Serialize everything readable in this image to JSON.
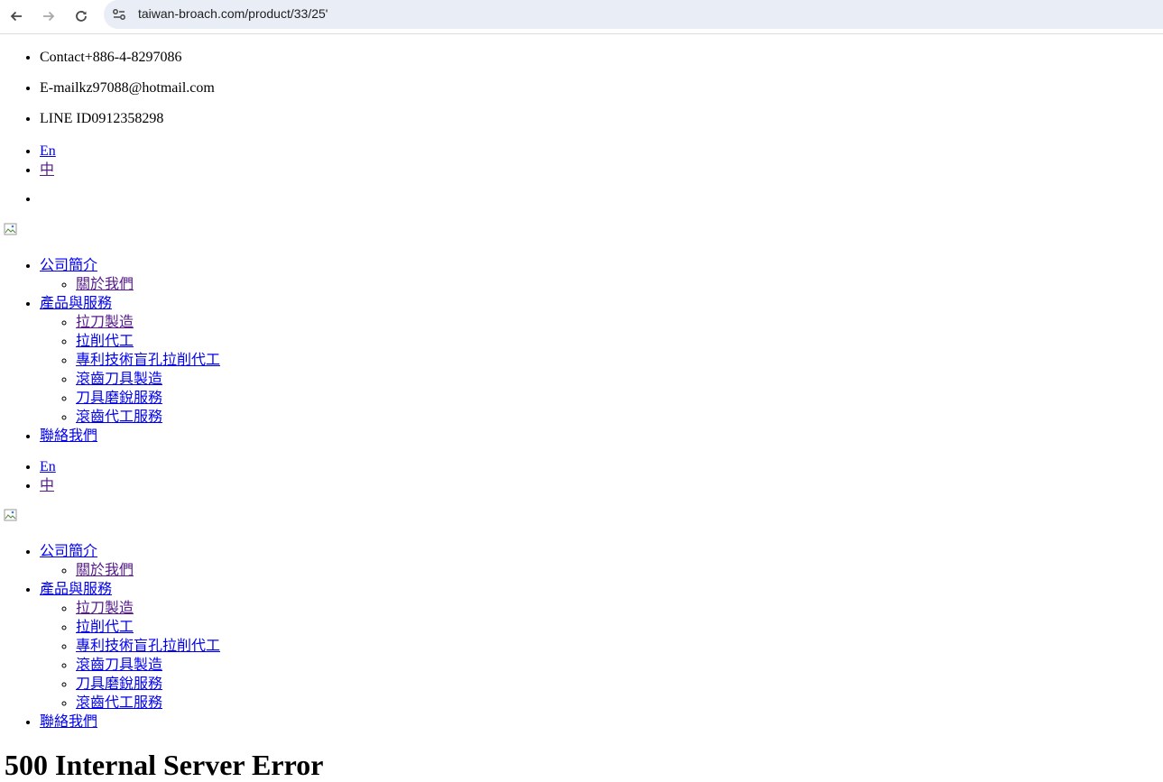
{
  "browser": {
    "url": "taiwan-broach.com/product/33/25'"
  },
  "contact": {
    "phone": "Contact+886-4-8297086",
    "email": "E-mailkz97088@hotmail.com",
    "line": "LINE ID0912358298"
  },
  "lang": {
    "en": "En",
    "zh": "中"
  },
  "menu": {
    "about": "公司簡介",
    "about_us": "關於我們",
    "products": "產品與服務",
    "p1": "拉刀製造",
    "p2": "拉削代工",
    "p3": "專利技術盲孔拉削代工",
    "p4": "滾齒刀具製造",
    "p5": "刀具磨銳服務",
    "p6": "滾齒代工服務",
    "contact": "聯絡我們"
  },
  "error": {
    "heading": "500 Internal Server Error"
  }
}
